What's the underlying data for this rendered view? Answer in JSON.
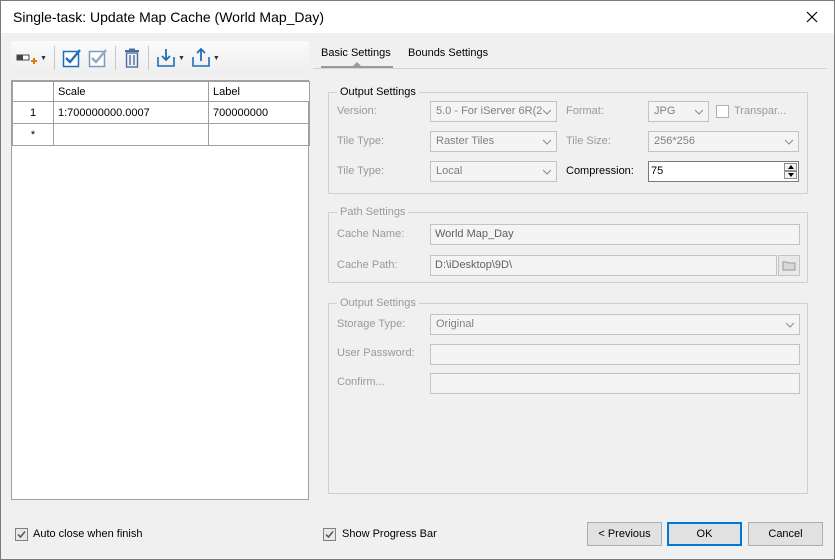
{
  "window": {
    "title": "Single-task: Update Map Cache (World Map_Day)"
  },
  "toolbar": {
    "icons": [
      "add-scale-icon",
      "select-all-icon",
      "select-inverse-icon",
      "delete-icon",
      "import-icon",
      "export-icon"
    ]
  },
  "grid": {
    "columns": [
      "",
      "Scale",
      "Label"
    ],
    "rows": [
      {
        "index": "1",
        "scale": "1:700000000.0007",
        "label": "700000000"
      },
      {
        "index": "*",
        "scale": "",
        "label": ""
      }
    ]
  },
  "tabs": [
    {
      "label": "Basic Settings",
      "active": true
    },
    {
      "label": "Bounds Settings",
      "active": false
    }
  ],
  "output_settings": {
    "legend": "Output Settings",
    "version_label": "Version:",
    "version_value": "5.0 - For iServer 6R(2",
    "format_label": "Format:",
    "format_value": "JPG",
    "transparent_label": "Transpar...",
    "tile_type_label": "Tile Type:",
    "tile_type_value": "Raster Tiles",
    "tile_size_label": "Tile Size:",
    "tile_size_value": "256*256",
    "storage_label": "Tile Type:",
    "storage_value": "Local",
    "compression_label": "Compression:",
    "compression_value": "75"
  },
  "path_settings": {
    "legend": "Path Settings",
    "cache_name_label": "Cache Name:",
    "cache_name_value": "World Map_Day",
    "cache_path_label": "Cache Path:",
    "cache_path_value": "D:\\iDesktop\\9D\\"
  },
  "output_settings2": {
    "legend": "Output Settings",
    "storage_type_label": "Storage Type:",
    "storage_type_value": "Original",
    "user_password_label": "User Password:",
    "confirm_label": "Confirm..."
  },
  "footer": {
    "auto_close_label": "Auto close when finish",
    "auto_close_checked": true,
    "show_progress_label": "Show Progress Bar",
    "show_progress_checked": true,
    "previous_label": "< Previous",
    "ok_label": "OK",
    "cancel_label": "Cancel"
  },
  "colors": {
    "accent": "#0078d7",
    "check_blue": "#1e6fb8"
  }
}
